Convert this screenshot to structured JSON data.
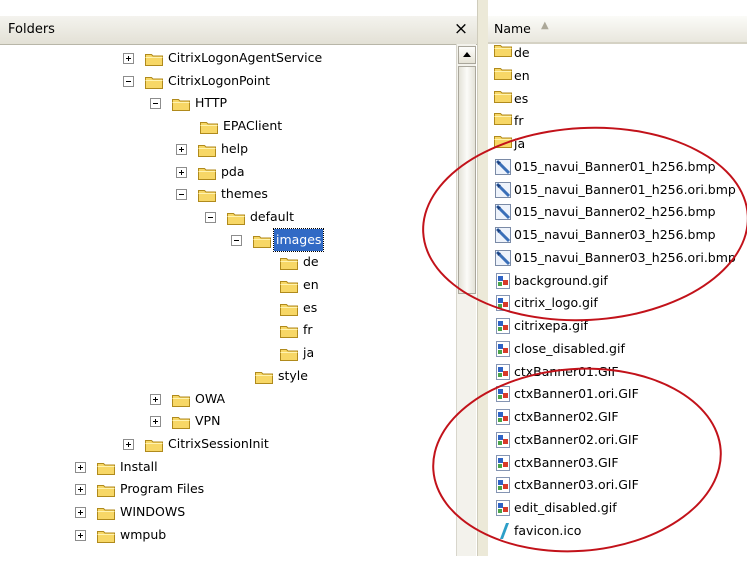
{
  "folders_pane": {
    "title": "Folders",
    "close_glyph": "×",
    "tree": [
      {
        "label": "CitrixLogonAgentService",
        "level": 0,
        "expander": "plus"
      },
      {
        "label": "CitrixLogonPoint",
        "level": 0,
        "expander": "minus"
      },
      {
        "label": "HTTP",
        "level": 1,
        "expander": "minus"
      },
      {
        "label": "EPAClient",
        "level": 2,
        "expander": "none"
      },
      {
        "label": "help",
        "level": 2,
        "expander": "plus"
      },
      {
        "label": "pda",
        "level": 2,
        "expander": "plus"
      },
      {
        "label": "themes",
        "level": 2,
        "expander": "minus"
      },
      {
        "label": "default",
        "level": 3,
        "expander": "minus"
      },
      {
        "label": "images",
        "level": 4,
        "expander": "minus",
        "selected": true
      },
      {
        "label": "de",
        "level": 5,
        "expander": "none"
      },
      {
        "label": "en",
        "level": 5,
        "expander": "none"
      },
      {
        "label": "es",
        "level": 5,
        "expander": "none"
      },
      {
        "label": "fr",
        "level": 5,
        "expander": "none"
      },
      {
        "label": "ja",
        "level": 5,
        "expander": "none"
      },
      {
        "label": "style",
        "level": 4,
        "expander": "none"
      },
      {
        "label": "OWA",
        "level": 1,
        "expander": "plus"
      },
      {
        "label": "VPN",
        "level": 1,
        "expander": "plus"
      },
      {
        "label": "CitrixSessionInit",
        "level": 0,
        "expander": "plus"
      },
      {
        "label": "Install",
        "level": -1,
        "expander": "plus"
      },
      {
        "label": "Program Files",
        "level": -1,
        "expander": "plus"
      },
      {
        "label": "WINDOWS",
        "level": -1,
        "expander": "plus"
      },
      {
        "label": "wmpub",
        "level": -1,
        "expander": "plus"
      }
    ]
  },
  "files_pane": {
    "column_header": "Name",
    "sort_indicator": "▲",
    "files": [
      {
        "name": "de",
        "type": "folder"
      },
      {
        "name": "en",
        "type": "folder"
      },
      {
        "name": "es",
        "type": "folder"
      },
      {
        "name": "fr",
        "type": "folder"
      },
      {
        "name": "ja",
        "type": "folder"
      },
      {
        "name": "015_navui_Banner01_h256.bmp",
        "type": "bmp"
      },
      {
        "name": "015_navui_Banner01_h256.ori.bmp",
        "type": "bmp"
      },
      {
        "name": "015_navui_Banner02_h256.bmp",
        "type": "bmp"
      },
      {
        "name": "015_navui_Banner03_h256.bmp",
        "type": "bmp"
      },
      {
        "name": "015_navui_Banner03_h256.ori.bmp",
        "type": "bmp"
      },
      {
        "name": "background.gif",
        "type": "gif"
      },
      {
        "name": "citrix_logo.gif",
        "type": "gif"
      },
      {
        "name": "citrixepa.gif",
        "type": "gif"
      },
      {
        "name": "close_disabled.gif",
        "type": "gif"
      },
      {
        "name": "ctxBanner01.GIF",
        "type": "gif"
      },
      {
        "name": "ctxBanner01.ori.GIF",
        "type": "gif"
      },
      {
        "name": "ctxBanner02.GIF",
        "type": "gif"
      },
      {
        "name": "ctxBanner02.ori.GIF",
        "type": "gif"
      },
      {
        "name": "ctxBanner03.GIF",
        "type": "gif"
      },
      {
        "name": "ctxBanner03.ori.GIF",
        "type": "gif"
      },
      {
        "name": "edit_disabled.gif",
        "type": "gif"
      },
      {
        "name": "favicon.ico",
        "type": "ico"
      }
    ]
  },
  "colors": {
    "selection": "#316ac5",
    "folder_fill": "#f7d766",
    "annotation": "#c2121a"
  }
}
